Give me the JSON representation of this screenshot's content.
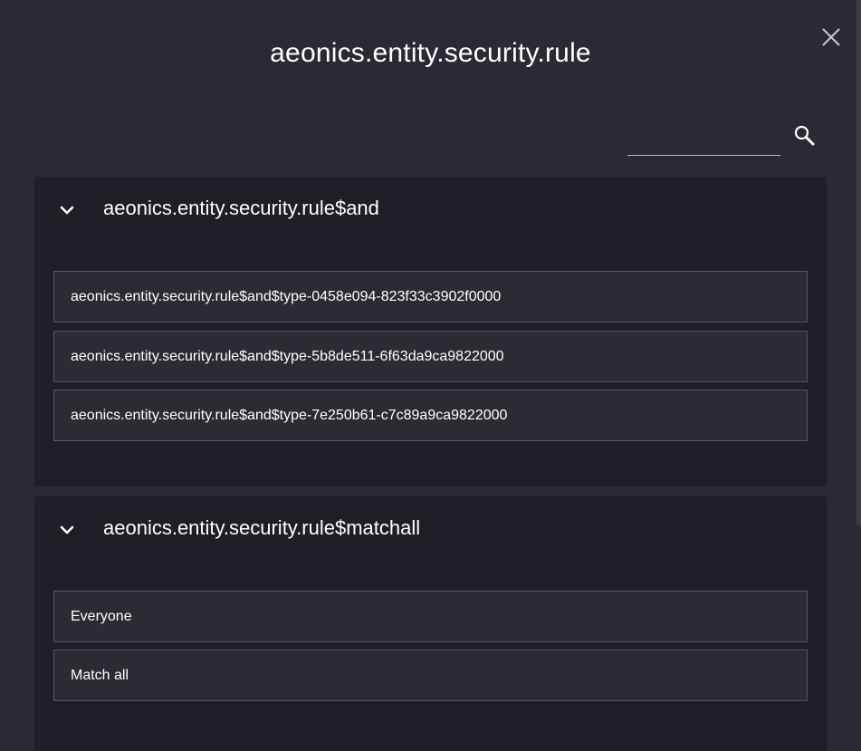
{
  "dialog": {
    "title": "aeonics.entity.security.rule"
  },
  "search": {
    "value": "",
    "placeholder": ""
  },
  "groups": [
    {
      "title": "aeonics.entity.security.rule$and",
      "items": [
        "aeonics.entity.security.rule$and$type-0458e094-823f33c3902f0000",
        "aeonics.entity.security.rule$and$type-5b8de511-6f63da9ca9822000",
        "aeonics.entity.security.rule$and$type-7e250b61-c7c89a9ca9822000"
      ]
    },
    {
      "title": "aeonics.entity.security.rule$matchall",
      "items": [
        "Everyone",
        "Match all"
      ]
    }
  ],
  "icons": {
    "close": "close-icon",
    "search": "search-icon",
    "chevron": "chevron-down-icon"
  },
  "colors": {
    "background": "#2a2a35",
    "panel": "#1e1e26",
    "item": "#2c2b33",
    "item_border": "#55555e",
    "text": "#ffffff"
  }
}
